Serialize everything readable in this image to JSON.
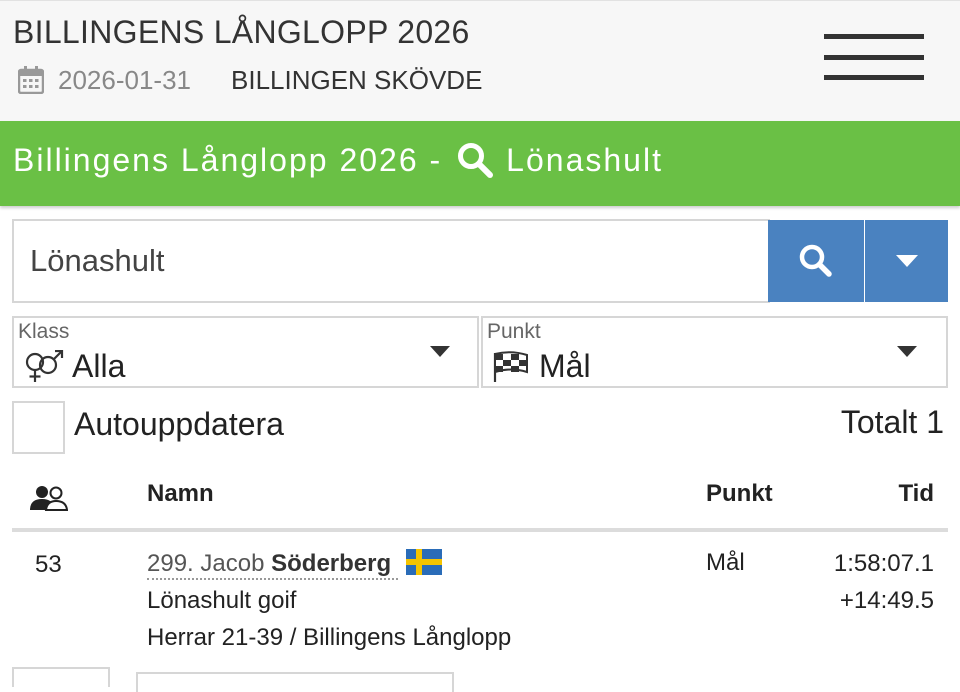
{
  "header": {
    "title": "BILLINGENS LÅNGLOPP 2026",
    "date": "2026-01-31",
    "location": "BILLINGEN SKÖVDE",
    "date_icon": "calendar-icon",
    "menu_icon": "hamburger-menu-icon"
  },
  "banner": {
    "prefix": "Billingens Långlopp 2026 -",
    "search_term": "Lönashult",
    "icon": "search-icon",
    "background": "#6ac045"
  },
  "search": {
    "value": "Lönashult",
    "button_icon": "search-icon",
    "dropdown_icon": "caret-down-icon",
    "button_color": "#4a82c0"
  },
  "filters": {
    "class": {
      "label": "Klass",
      "value": "Alla",
      "icon": "gender-icon"
    },
    "point": {
      "label": "Punkt",
      "value": "Mål",
      "icon": "checkered-flag-icon"
    }
  },
  "auto_update": {
    "label": "Autouppdatera",
    "checked": false
  },
  "total": "Totalt 1",
  "table": {
    "columns": {
      "place_icon": "participants-icon",
      "name": "Namn",
      "point": "Punkt",
      "time": "Tid"
    },
    "rows": [
      {
        "place": "53",
        "bib": "299.",
        "first_name": "Jacob",
        "last_name": "Söderberg",
        "flag": "sweden-flag-icon",
        "club": "Lönashult goif",
        "class": "Herrar 21-39 / Billingens Långlopp",
        "point": "Mål",
        "time": "1:58:07.1",
        "diff": "+14:49.5"
      }
    ]
  }
}
